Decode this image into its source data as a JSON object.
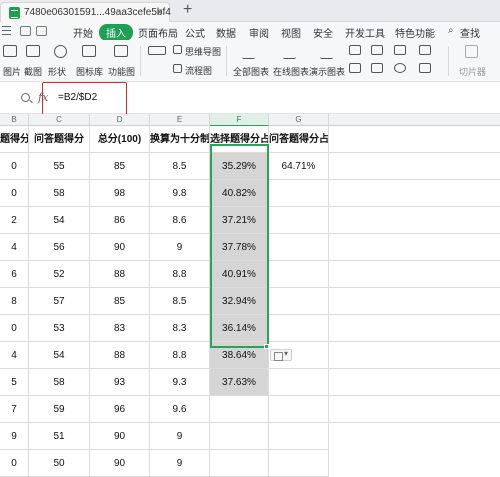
{
  "window": {
    "tab_title": "7480e06301591...49aa3cefe5bf4",
    "close_glyph": "×",
    "add_glyph": "+"
  },
  "menu": {
    "items": [
      "开始",
      "插入",
      "页面布局",
      "公式",
      "数据",
      "审阅",
      "视图",
      "安全",
      "开发工具",
      "特色功能"
    ],
    "active": "插入",
    "search": "查找",
    "accent": "#1ea055"
  },
  "ribbon": {
    "labels": [
      "图片",
      "形状",
      "图标库",
      "功能图",
      "思维导图",
      "流程图",
      "全部图表",
      "在线图表",
      "演示图表",
      "切片器"
    ],
    "partial_label": "截图"
  },
  "formula_bar": {
    "fx": "fx",
    "formula": "=B2/$D2",
    "highlight_color": "#e02a2a"
  },
  "sheet": {
    "columns": [
      "B",
      "C",
      "D",
      "E",
      "F",
      "G"
    ],
    "selected_column": "F",
    "headers": [
      "题得分",
      "问答题得分",
      "总分(100)",
      "换算为十分制",
      "选择题得分占比",
      "问答题得分占比"
    ],
    "rows": [
      [
        "0",
        "55",
        "85",
        "8.5",
        "35.29%",
        "64.71%"
      ],
      [
        "0",
        "58",
        "98",
        "9.8",
        "40.82%",
        ""
      ],
      [
        "2",
        "54",
        "86",
        "8.6",
        "37.21%",
        ""
      ],
      [
        "4",
        "56",
        "90",
        "9",
        "37.78%",
        ""
      ],
      [
        "6",
        "52",
        "88",
        "8.8",
        "40.91%",
        ""
      ],
      [
        "8",
        "57",
        "85",
        "8.5",
        "32.94%",
        ""
      ],
      [
        "0",
        "53",
        "83",
        "8.3",
        "36.14%",
        ""
      ],
      [
        "4",
        "54",
        "88",
        "8.8",
        "38.64%",
        ""
      ],
      [
        "5",
        "58",
        "93",
        "9.3",
        "37.63%",
        ""
      ],
      [
        "7",
        "59",
        "96",
        "9.6",
        "",
        ""
      ],
      [
        "9",
        "51",
        "90",
        "9",
        "",
        ""
      ],
      [
        "0",
        "50",
        "90",
        "9",
        "",
        ""
      ]
    ],
    "selection_color": "#2aa35a"
  }
}
